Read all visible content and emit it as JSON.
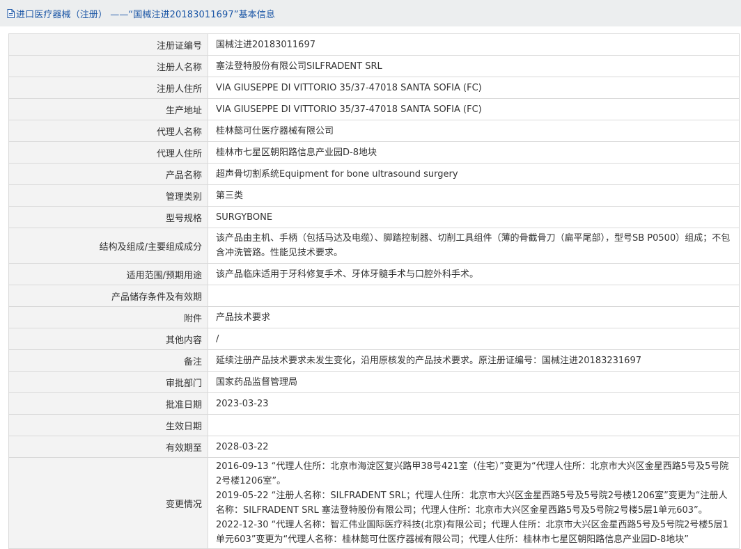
{
  "header": {
    "title": "进口医疗器械（注册） ——“国械注进20183011697”基本信息"
  },
  "rows": [
    {
      "label": "注册证编号",
      "value": "国械注进20183011697"
    },
    {
      "label": "注册人名称",
      "value": "塞法登特股份有限公司SILFRADENT SRL"
    },
    {
      "label": "注册人住所",
      "value": "VIA GIUSEPPE DI VITTORIO 35/37-47018 SANTA SOFIA (FC)"
    },
    {
      "label": "生产地址",
      "value": "VIA GIUSEPPE DI VITTORIO 35/37-47018 SANTA SOFIA (FC)"
    },
    {
      "label": "代理人名称",
      "value": "桂林懿可仕医疗器械有限公司"
    },
    {
      "label": "代理人住所",
      "value": "桂林市七星区朝阳路信息产业园D-8地块"
    },
    {
      "label": "产品名称",
      "value": "超声骨切割系统Equipment for bone ultrasound surgery"
    },
    {
      "label": "管理类别",
      "value": "第三类"
    },
    {
      "label": "型号规格",
      "value": "SURGYBONE"
    },
    {
      "label": "结构及组成/主要组成成分",
      "value": "该产品由主机、手柄（包括马达及电缆）、脚踏控制器、切削工具组件（薄的骨截骨刀（扁平尾部），型号SB P0500）组成；不包含冲洗管路。性能见技术要求。"
    },
    {
      "label": "适用范围/预期用途",
      "value": "该产品临床适用于牙科修复手术、牙体牙髓手术与口腔外科手术。"
    },
    {
      "label": "产品储存条件及有效期",
      "value": ""
    },
    {
      "label": "附件",
      "value": "产品技术要求"
    },
    {
      "label": "其他内容",
      "value": "/"
    },
    {
      "label": "备注",
      "value": "延续注册产品技术要求未发生变化，沿用原核发的产品技术要求。原注册证编号：国械注进20183231697"
    },
    {
      "label": "审批部门",
      "value": "国家药品监督管理局"
    },
    {
      "label": "批准日期",
      "value": "2023-03-23"
    },
    {
      "label": "生效日期",
      "value": ""
    },
    {
      "label": "有效期至",
      "value": "2028-03-22"
    }
  ],
  "change_history": {
    "label": "变更情况",
    "entries": [
      "2016-09-13 “代理人住所：北京市海淀区复兴路甲38号421室（住宅）”变更为“代理人住所：北京市大兴区金星西路5号及5号院2号楼1206室”。",
      "2019-05-22 “注册人名称：SILFRADENT SRL；代理人住所：北京市大兴区金星西路5号及5号院2号楼1206室”变更为“注册人名称：SILFRADENT SRL 塞法登特股份有限公司；代理人住所：北京市大兴区金星西路5号及5号院2号楼5层1单元603”。",
      "2022-12-30 “代理人名称：智汇伟业国际医疗科技(北京)有限公司；代理人住所：北京市大兴区金星西路5号及5号院2号楼5层1单元603”变更为“代理人名称：桂林懿可仕医疗器械有限公司；代理人住所：桂林市七星区朝阳路信息产业园D-8地块”"
    ]
  },
  "colors": {
    "title_text": "#1b56a6",
    "title_bg": "#eceeef",
    "label_bg": "#f3f3f3",
    "border": "#d9d9d9",
    "text": "#333333"
  },
  "icons": {
    "title_icon": "document-icon"
  }
}
